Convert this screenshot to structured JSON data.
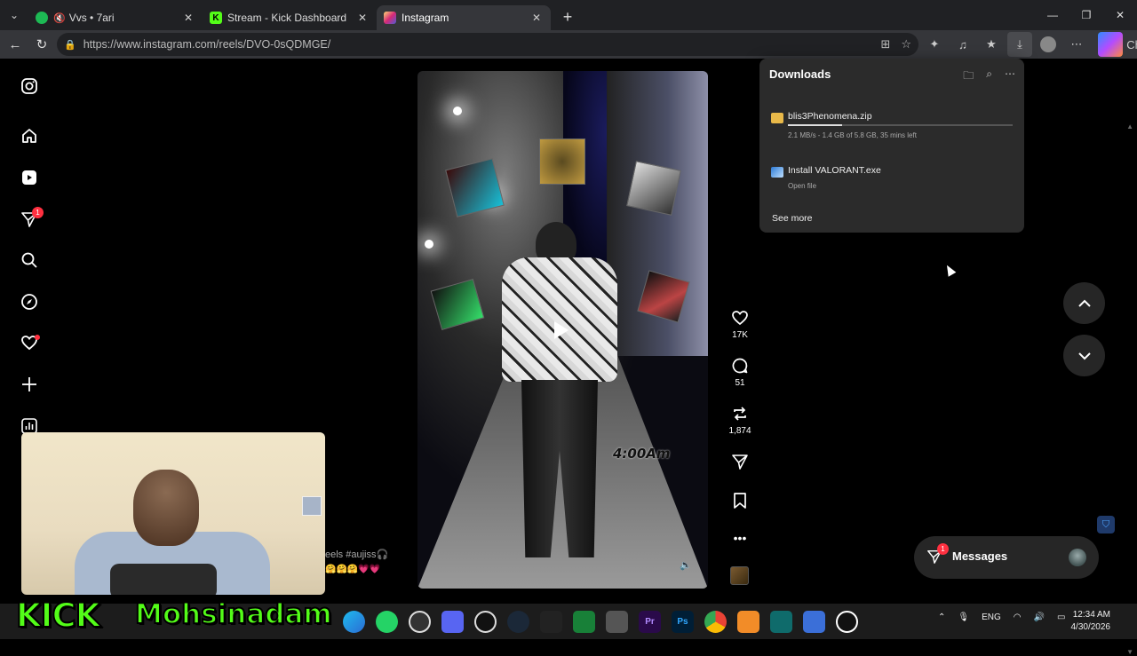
{
  "browser": {
    "tabs": [
      {
        "title": "Vvs • 7ari",
        "favicon": "spotify-icon",
        "color": "#1db954",
        "muted": true
      },
      {
        "title": "Stream - Kick Dashboard",
        "favicon": "kick-icon",
        "color": "#53fc18",
        "muted": false
      },
      {
        "title": "Instagram",
        "favicon": "instagram-icon",
        "color": "#e1306c",
        "active": true
      }
    ],
    "url": "https://www.instagram.com/reels/DVO-0sQDMGE/",
    "chat_label": "Chat"
  },
  "downloads": {
    "title": "Downloads",
    "items": [
      {
        "name": "blis3Phenomena.zip",
        "meta": "2.1 MB/s - 1.4 GB of 5.8 GB, 35 mins left",
        "progress": 0.24,
        "icon": "folder-zip-icon"
      },
      {
        "name": "Install VALORANT.exe",
        "meta": "Open file",
        "icon": "exe-icon"
      }
    ],
    "see_more": "See more"
  },
  "reel": {
    "overlay_text": "4:00Am",
    "likes": "17K",
    "comments": "51",
    "reposts": "1,874"
  },
  "sidebar": {
    "notification_count": "1"
  },
  "messages": {
    "label": "Messages",
    "badge": "1"
  },
  "caption": {
    "text": "eels #aujiss🎧",
    "emojis": "🤗🤗🤗💗💗"
  },
  "stream_overlay": {
    "brand": "KICK",
    "username": "Mohsinadam"
  },
  "taskbar": {
    "language": "ENG",
    "time": "12:34 AM",
    "date": "4/30/2026"
  }
}
